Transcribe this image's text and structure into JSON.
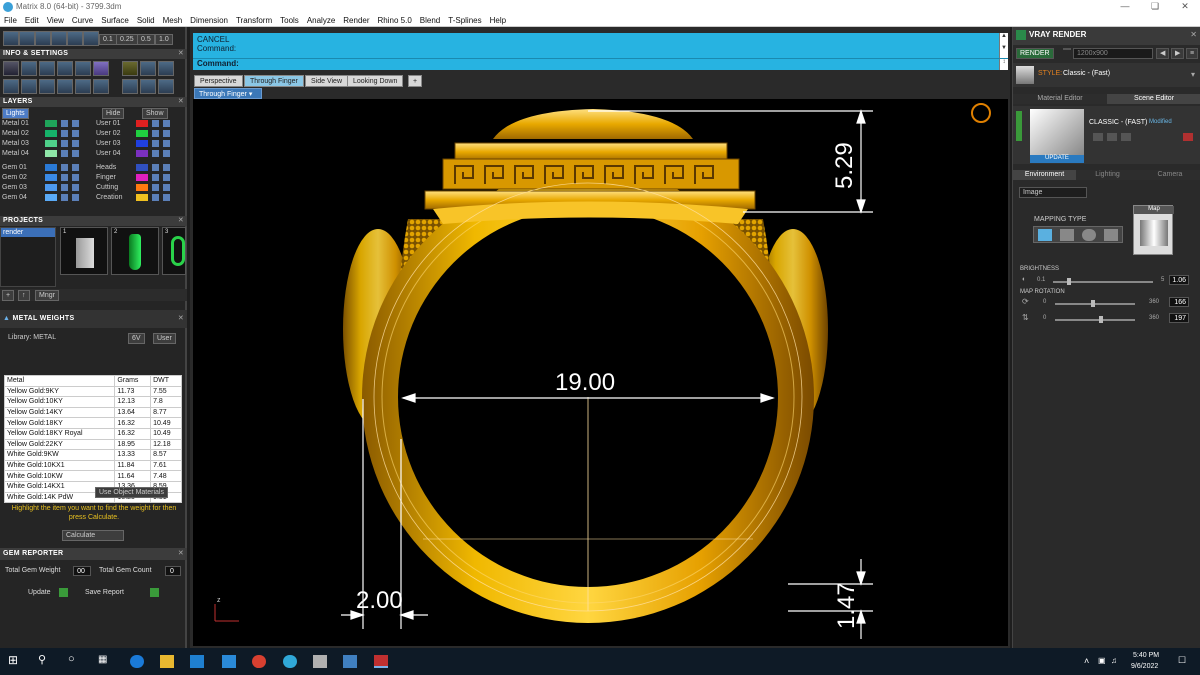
{
  "window": {
    "title": "Matrix 8.0 (64-bit) - 3799.3dm"
  },
  "menu": [
    "File",
    "Edit",
    "View",
    "Curve",
    "Surface",
    "Solid",
    "Mesh",
    "Dimension",
    "Transform",
    "Tools",
    "Analyze",
    "Render",
    "Rhino 5.0",
    "Blend",
    "T-Splines",
    "Help"
  ],
  "toolbar": {
    "v1": "0.1",
    "v2": "0.25",
    "v3": "0.5",
    "v4": "1.0"
  },
  "left": {
    "info_header": "INFO & SETTINGS",
    "layers_header": "LAYERS",
    "layers_lights": "Lights",
    "layers_hide": "Hide",
    "layers_show": "Show",
    "layers_left": [
      "Metal 01",
      "Metal 02",
      "Metal 03",
      "Metal 04",
      "Gem 01",
      "Gem 02",
      "Gem 03",
      "Gem 04"
    ],
    "layers_right": [
      "User 01",
      "User 02",
      "User 03",
      "User 04",
      "Heads",
      "Finger",
      "Cutting",
      "Creation"
    ],
    "layers_left_colors": [
      "#1fa45a",
      "#16b36a",
      "#4fd08a",
      "#8fe6a8",
      "#2a7ad6",
      "#3a8ae6",
      "#4d9af0",
      "#5aaaf6"
    ],
    "layers_right_colors": [
      "#e02020",
      "#20d040",
      "#2040e0",
      "#7a30c0",
      "#3050c0",
      "#e020c0",
      "#ff7a10",
      "#f0c020"
    ],
    "projects_header": "PROJECTS",
    "projects_item": "render",
    "projects_mngr": "Mngr",
    "proj_nums": [
      "1",
      "2",
      "3"
    ],
    "metal_header": "METAL WEIGHTS",
    "library": "Library: METAL",
    "lib_btn1": "6V",
    "lib_btn2": "User",
    "table_headers": [
      "Metal",
      "Grams",
      "DWT"
    ],
    "table_rows": [
      [
        "Yellow Gold:9KY",
        "11.73",
        "7.55"
      ],
      [
        "Yellow Gold:10KY",
        "12.13",
        "7.8"
      ],
      [
        "Yellow Gold:14KY",
        "13.64",
        "8.77"
      ],
      [
        "Yellow Gold:18KY",
        "16.32",
        "10.49"
      ],
      [
        "Yellow Gold:18KY Royal",
        "16.32",
        "10.49"
      ],
      [
        "Yellow Gold:22KY",
        "18.95",
        "12.18"
      ],
      [
        "White Gold:9KW",
        "13.33",
        "8.57"
      ],
      [
        "White Gold:10KX1",
        "11.84",
        "7.61"
      ],
      [
        "White Gold:10KW",
        "11.64",
        "7.48"
      ],
      [
        "White Gold:14KX1",
        "13.36",
        "8.59"
      ],
      [
        "White Gold:14K PdW",
        "15.25",
        "9.81"
      ]
    ],
    "use_object": "Use Object Materials",
    "hint": "Highlight the item you want to find the weight for then press Calculate.",
    "calculate": "Calculate",
    "gem_header": "GEM REPORTER",
    "total_gem_weight": "Total Gem Weight",
    "total_gem_weight_val": "00",
    "total_gem_count": "Total Gem Count",
    "total_gem_count_val": "0",
    "update": "Update",
    "save_report": "Save Report"
  },
  "command": {
    "line1": "CANCEL",
    "line2": "Command:",
    "prompt": "Command:"
  },
  "tabs": [
    "Perspective",
    "Through Finger",
    "Side View",
    "Looking Down"
  ],
  "tabs_add": "+",
  "view_label": "Through Finger",
  "dims": {
    "top": "5.29",
    "width": "19.00",
    "bottom_left": "2.00",
    "bottom_right": "1.47"
  },
  "axis": "z",
  "right": {
    "header": "VRAY RENDER",
    "render_btn": "RENDER",
    "resolution": "1200x900",
    "style_label": "STYLE:",
    "style_value": "Classic - (Fast)",
    "tab_material": "Material Editor",
    "tab_scene": "Scene Editor",
    "preset_name": "CLASSIC - (FAST)",
    "preset_mod": "Modified",
    "update_btn": "UPDATE",
    "subtabs": [
      "Environment",
      "Lighting",
      "Camera"
    ],
    "env_type": "Image",
    "mapping_type": "MAPPING TYPE",
    "map_label": "Map",
    "brightness": "BRIGHTNESS",
    "brightness_min": "0.1",
    "brightness_max": "5",
    "brightness_val": "1.06",
    "map_rotation": "MAP ROTATION",
    "rot1_min": "0",
    "rot1_max": "360",
    "rot1_val": "166",
    "rot2_min": "0",
    "rot2_max": "360",
    "rot2_val": "197"
  },
  "taskbar": {
    "time": "5:40 PM",
    "date": "9/6/2022"
  },
  "colors": {
    "cmd": "#27b3e1",
    "gold": "#e6a400",
    "dim": "#ffffff"
  }
}
